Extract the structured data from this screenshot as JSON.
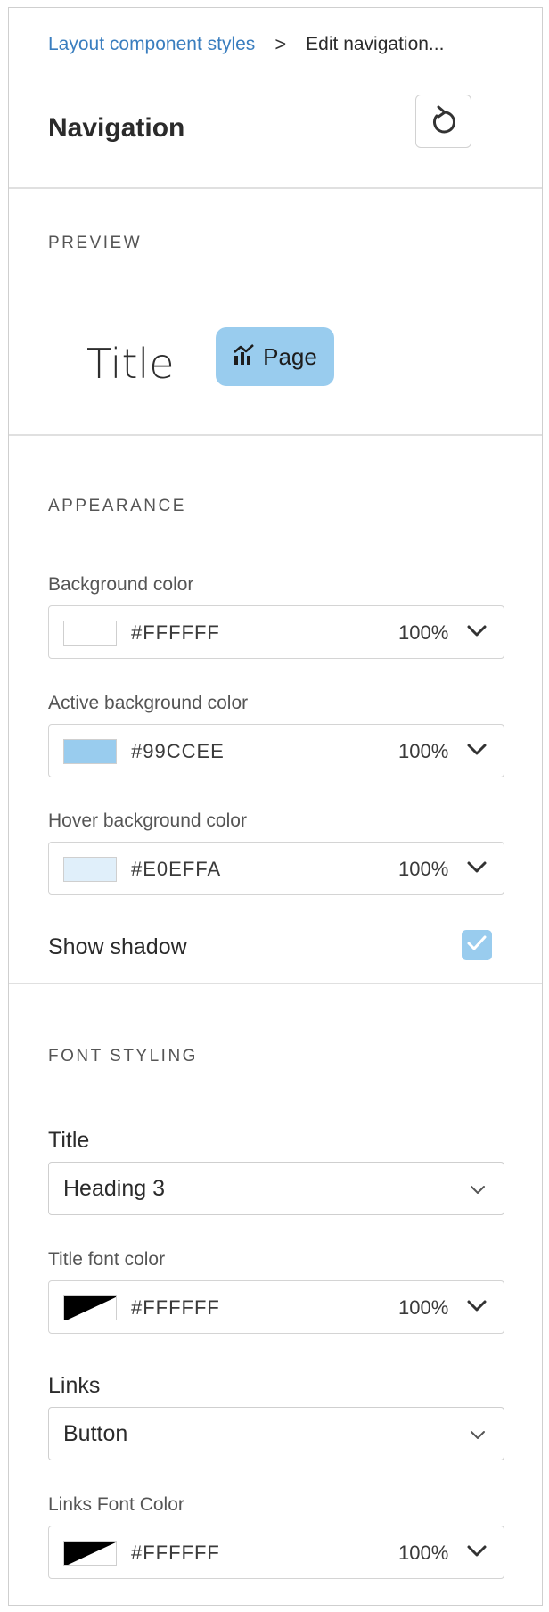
{
  "breadcrumb": {
    "parent": "Layout component styles",
    "separator": ">",
    "current": "Edit navigation..."
  },
  "header": {
    "title": "Navigation",
    "reset_icon": "reset-icon"
  },
  "preview": {
    "section_label": "PREVIEW",
    "title_text": "Title",
    "page_button_label": "Page",
    "page_icon": "chart-icon"
  },
  "appearance": {
    "section_label": "APPEARANCE",
    "background": {
      "label": "Background color",
      "hex": "#FFFFFF",
      "opacity": "100%",
      "swatch_color": "#FFFFFF"
    },
    "active_background": {
      "label": "Active background color",
      "hex": "#99CCEE",
      "opacity": "100%",
      "swatch_color": "#99CCEE"
    },
    "hover_background": {
      "label": "Hover background color",
      "hex": "#E0EFFA",
      "opacity": "100%",
      "swatch_color": "#E0EFFA"
    },
    "show_shadow": {
      "label": "Show shadow",
      "checked": true
    }
  },
  "font_styling": {
    "section_label": "FONT STYLING",
    "title": {
      "label": "Title",
      "value": "Heading 3"
    },
    "title_font_color": {
      "label": "Title font color",
      "hex": "#FFFFFF",
      "opacity": "100%"
    },
    "links": {
      "label": "Links",
      "value": "Button"
    },
    "links_font_color": {
      "label": "Links Font Color",
      "hex": "#FFFFFF",
      "opacity": "100%"
    }
  },
  "colors": {
    "link": "#3A7EBF",
    "accent": "#99CCEE"
  }
}
